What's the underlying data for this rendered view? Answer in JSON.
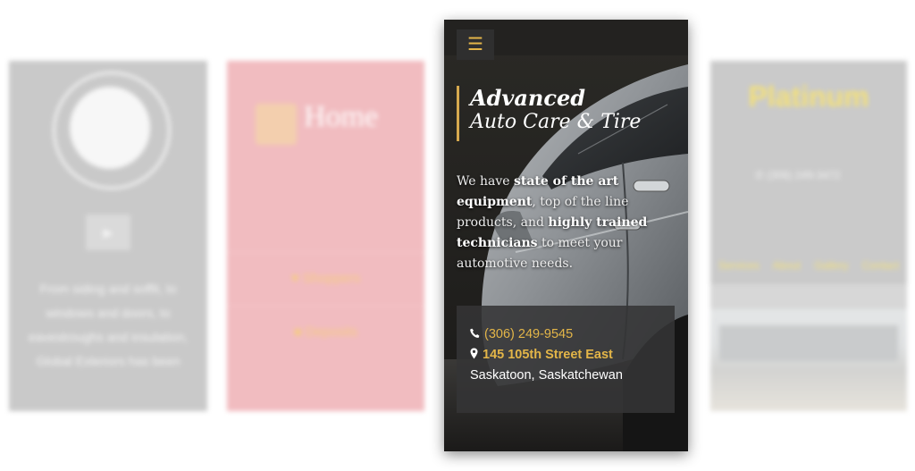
{
  "background_cards": {
    "left": {
      "text": "From siding and soffit, to windows and doors, to eavestroughs and insulation, Global Exteriors has been"
    },
    "left_center": {
      "items": [
        "Shoppers",
        "Deposits"
      ]
    },
    "right": {
      "info": [
        "(306) 249-3472"
      ],
      "nav": [
        "Services",
        "About",
        "Gallery",
        "Contact"
      ]
    }
  },
  "site": {
    "menu_icon": "hamburger-menu-icon",
    "brand": {
      "line1": "Advanced",
      "line2": "Auto Care & Tire"
    },
    "intro": {
      "p1": "We have ",
      "b1": "state of the art equipment",
      "p2": ", top of the line products, and ",
      "b2": "highly trained technicians",
      "p3": " to meet your automotive needs."
    },
    "contact": {
      "phone": "(306) 249-9545",
      "address": "145 105th Street East",
      "city": "Saskatoon, Saskatchewan",
      "phone_icon": "phone-icon",
      "location_icon": "map-marker-icon"
    }
  },
  "colors": {
    "accent": "#e3b548",
    "brand_border": "#d6a94e",
    "contact_box": "#343436",
    "pink_card": "#f1bcc0"
  }
}
